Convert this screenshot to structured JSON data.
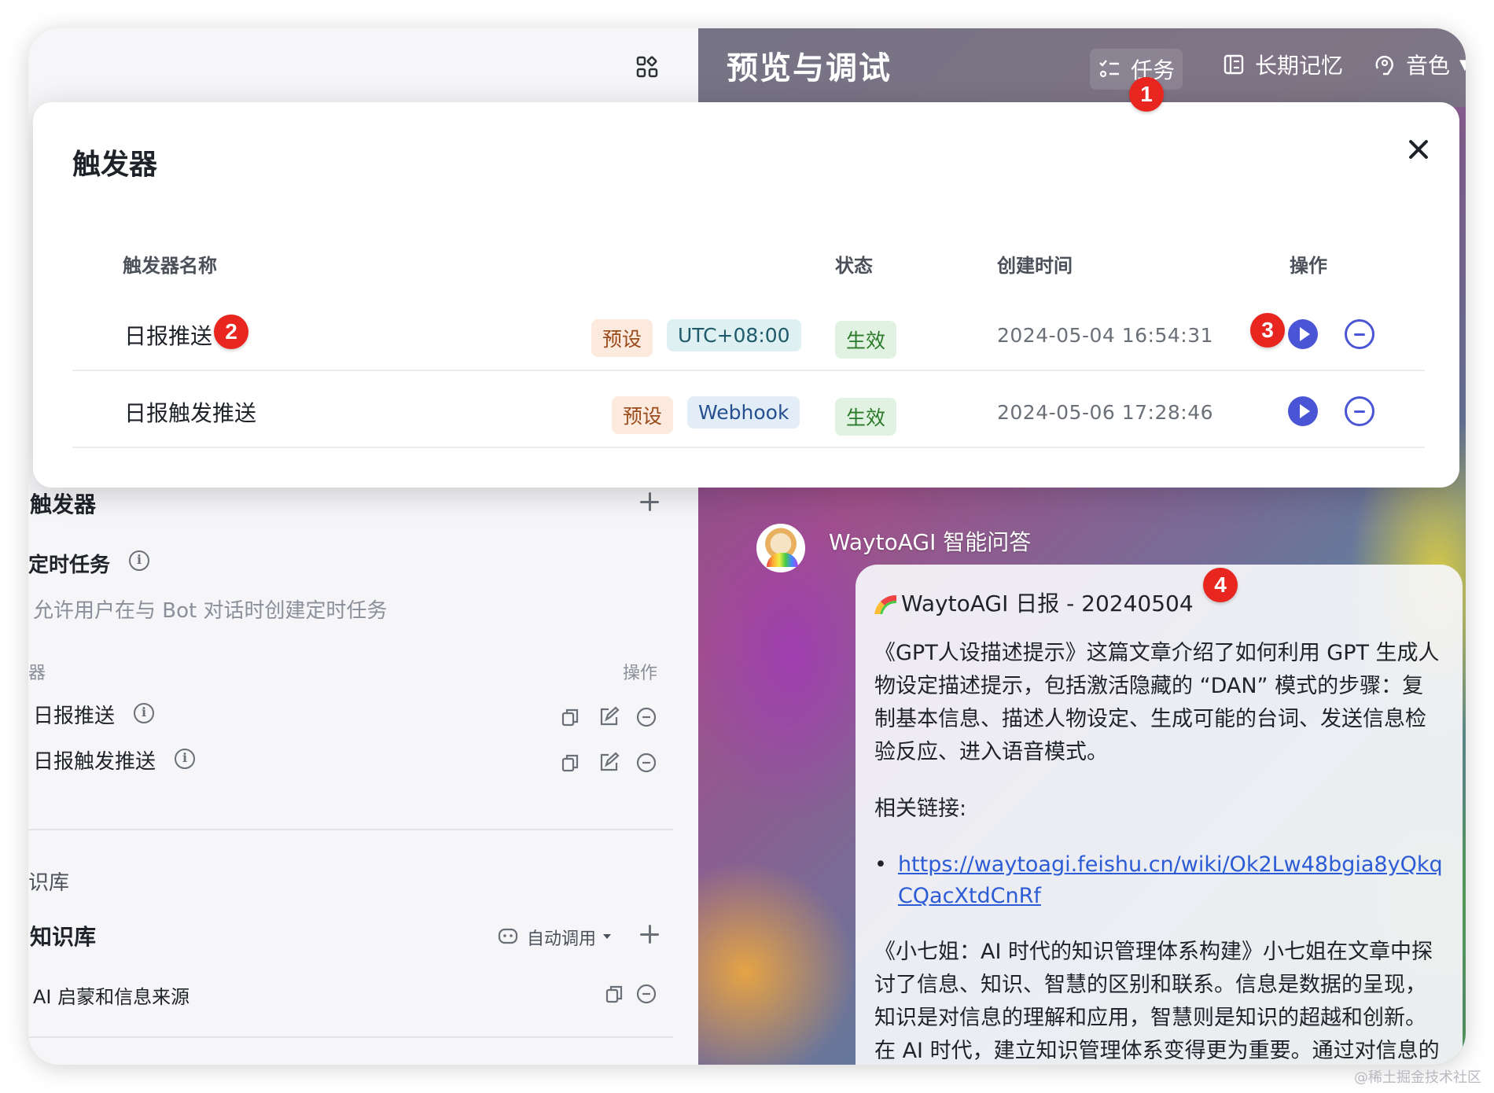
{
  "left_panel": {
    "trigger_section_title": "触发器",
    "scheduled_task_label": "定时任务",
    "scheduled_task_desc": "允许用户在与 Bot 对话时创建定时任务",
    "table_header_trigger": "器",
    "table_header_actions": "操作",
    "triggers": [
      {
        "name": "日报推送"
      },
      {
        "name": "日报触发推送"
      }
    ],
    "knowledge_section_partial": "识库",
    "knowledge_title": "知识库",
    "auto_call_label": "自动调用",
    "knowledge_items": [
      {
        "name": "AI 启蒙和信息来源"
      }
    ]
  },
  "right_header": {
    "title": "预览与调试",
    "tasks_label": "任务",
    "memory_label": "长期记忆",
    "voice_label": "音色"
  },
  "modal": {
    "title": "触发器",
    "columns": {
      "name": "触发器名称",
      "status": "状态",
      "created": "创建时间",
      "actions": "操作"
    },
    "rows": [
      {
        "name": "日报推送",
        "preset_tag": "预设",
        "type_tag": "UTC+08:00",
        "status": "生效",
        "created": "2024-05-04 16:54:31"
      },
      {
        "name": "日报触发推送",
        "preset_tag": "预设",
        "type_tag": "Webhook",
        "status": "生效",
        "created": "2024-05-06 17:28:46"
      }
    ]
  },
  "chat": {
    "bot_name": "WaytoAGI 智能问答",
    "message_title": "WaytoAGI 日报 - 20240504",
    "paragraph1": "《GPT人设描述提示》这篇文章介绍了如何利用 GPT 生成人物设定描述提示，包括激活隐藏的 “DAN” 模式的步骤：复制基本信息、描述人物设定、生成可能的台词、发送信息检验反应、进入语音模式。",
    "related_links_label": "相关链接:",
    "link": "https://waytoagi.feishu.cn/wiki/Ok2Lw48bgia8yQkqCQacXtdCnRf",
    "paragraph2": "《小七姐：AI 时代的知识管理体系构建》小七姐在文章中探讨了信息、知识、智慧的区别和联系。信息是数据的呈现，知识是对信息的理解和应用，智慧则是知识的超越和创新。在 AI 时代，建立知识管理体系变得更为重要。通过对信息的整理和加工，将其转化为知识，再进一步应用和"
  },
  "badges": [
    "1",
    "2",
    "3",
    "4"
  ],
  "watermark": "@稀土掘金技术社区",
  "colors": {
    "accent": "#4a55d6",
    "badge": "#e8251f",
    "link": "#2c5bd6"
  }
}
